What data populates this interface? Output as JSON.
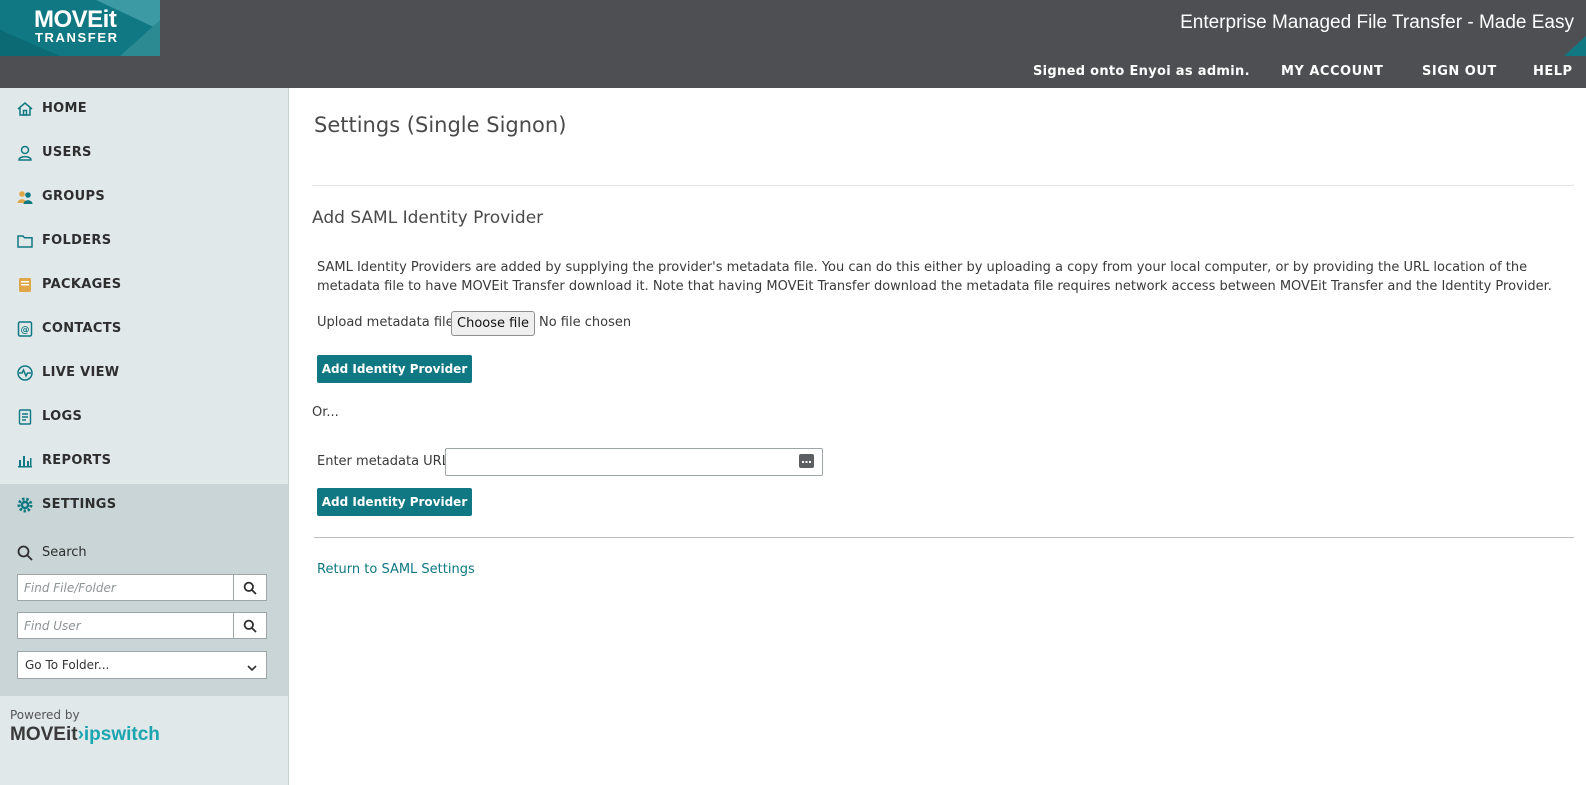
{
  "header": {
    "logo_main": "MOVEit",
    "logo_sub": "TRANSFER",
    "tagline": "Enterprise Managed File Transfer - Made Easy",
    "signed_in": "Signed onto Enyoi as admin.",
    "links": [
      "MY ACCOUNT",
      "SIGN OUT",
      "HELP"
    ]
  },
  "sidebar": {
    "items": [
      {
        "label": "HOME",
        "icon": "home-icon"
      },
      {
        "label": "USERS",
        "icon": "user-icon"
      },
      {
        "label": "GROUPS",
        "icon": "group-icon"
      },
      {
        "label": "FOLDERS",
        "icon": "folder-icon"
      },
      {
        "label": "PACKAGES",
        "icon": "package-icon"
      },
      {
        "label": "CONTACTS",
        "icon": "contacts-icon"
      },
      {
        "label": "LIVE VIEW",
        "icon": "live-view-icon"
      },
      {
        "label": "LOGS",
        "icon": "logs-icon"
      },
      {
        "label": "REPORTS",
        "icon": "reports-icon"
      },
      {
        "label": "SETTINGS",
        "icon": "gear-icon",
        "active": true
      }
    ],
    "search": {
      "label": "Search",
      "file_placeholder": "Find File/Folder",
      "user_placeholder": "Find User",
      "goto_folder": "Go To Folder..."
    },
    "powered_by": "Powered by",
    "brand_moveit": "MOVEit",
    "brand_ipswitch": "ipswitch"
  },
  "main": {
    "page_title": "Settings (Single Signon)",
    "section_title": "Add SAML Identity Provider",
    "description": "SAML Identity Providers are added by supplying the provider's metadata file. You can do this either by uploading a copy from your local computer, or by providing the URL location of the metadata file to have MOVEit Transfer download it. Note that having MOVEit Transfer download the metadata file requires network access between MOVEit Transfer and the Identity Provider.",
    "upload_label": "Upload metadata file:",
    "choose_file": "Choose file",
    "no_file": "No file chosen",
    "add_button": "Add Identity Provider",
    "or_text": "Or...",
    "url_label": "Enter metadata URL:",
    "url_value": "",
    "return_link": "Return to SAML Settings"
  },
  "colors": {
    "accent": "#0f7882",
    "header_bg": "#4d4f52",
    "sidebar_bg": "#e1e8e9",
    "active_bg": "#c9d5d7"
  }
}
